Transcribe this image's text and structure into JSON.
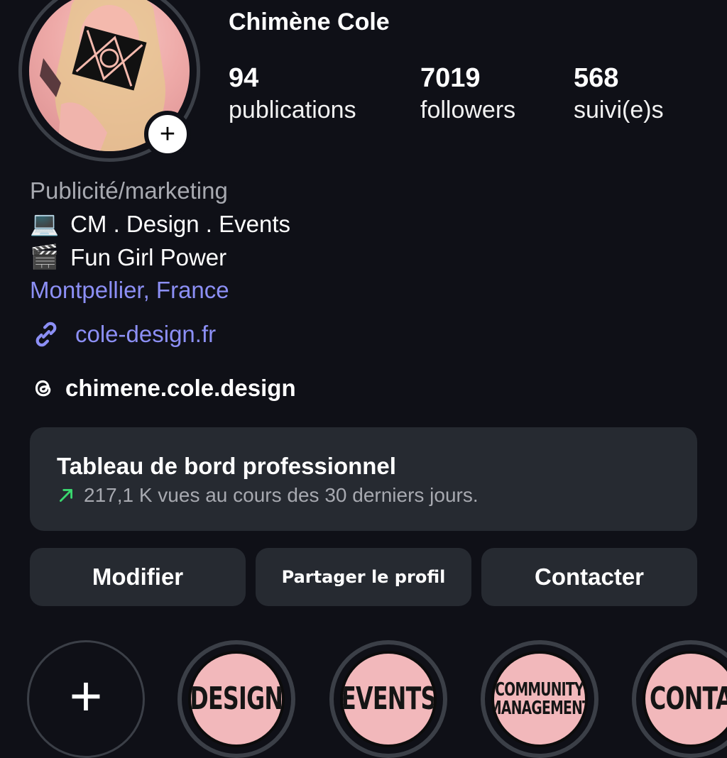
{
  "profile": {
    "username": "Chimène Cole",
    "add_badge": "+",
    "stats": [
      {
        "value": "94",
        "label": "publications"
      },
      {
        "value": "7019",
        "label": "followers"
      },
      {
        "value": "568",
        "label": "suivi(e)s"
      }
    ],
    "category": "Publicité/marketing",
    "bio_lines": [
      {
        "emoji": "💻",
        "text": "CM . Design . Events"
      },
      {
        "emoji": "🎬",
        "text": "Fun Girl Power"
      }
    ],
    "location": "Montpellier, France",
    "website": "cole-design.fr",
    "threads_handle": "chimene.cole.design",
    "link_icon": "link-icon",
    "threads_icon": "threads-icon"
  },
  "dashboard": {
    "title": "Tableau de bord professionnel",
    "subtitle": "217,1 K vues au cours des 30 derniers jours.",
    "trend_icon": "trend-up-arrow-icon",
    "accent": "#3ad86f"
  },
  "buttons": {
    "edit": "Modifier",
    "share": "Partager le profil",
    "contact": "Contacter"
  },
  "highlights": {
    "new_label": "+",
    "items": [
      {
        "label": "DESIGN"
      },
      {
        "label": "EVENTS"
      },
      {
        "label_line1": "COMMUNITY",
        "label_line2": "MANAGEMENT"
      },
      {
        "label": "CONTACT"
      }
    ]
  },
  "colors": {
    "background": "#0f1017",
    "card": "#262a31",
    "link": "#8c8ff5",
    "muted": "#a7a9b0",
    "highlight_fill": "#f2b8bb"
  }
}
